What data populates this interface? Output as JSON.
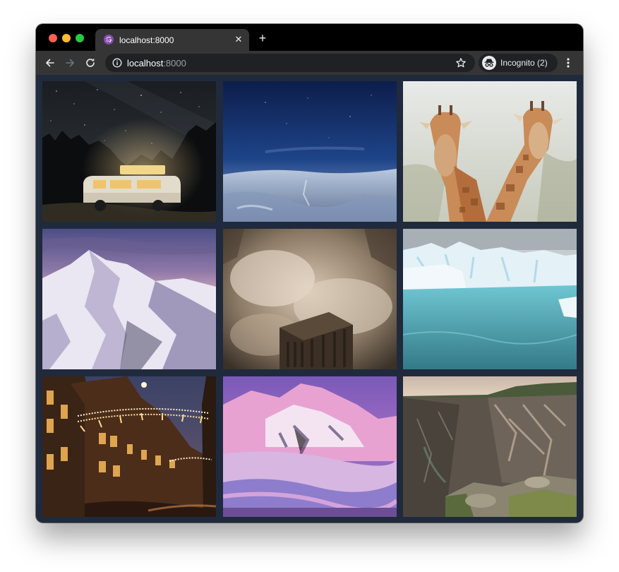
{
  "browser": {
    "tab_title": "localhost:8000",
    "tab_close_glyph": "✕",
    "new_tab_glyph": "+",
    "url_host": "localhost",
    "url_port": ":8000",
    "profile_label": "Incognito (2)"
  },
  "icons": {
    "back": "arrow-left-icon",
    "forward": "arrow-right-icon",
    "reload": "reload-icon",
    "info": "info-icon",
    "bookmark": "star-icon",
    "incognito": "incognito-icon",
    "menu": "kebab-menu-icon",
    "favicon": "gatsby-favicon-icon"
  },
  "colors": {
    "page_background": "#1f2a3d",
    "tabstrip": "#000000",
    "toolbar": "#353535",
    "omnibox": "#202124",
    "favicon": "#8a4baf"
  },
  "gallery": {
    "photos": [
      {
        "subject": "camper van under starry night sky"
      },
      {
        "subject": "snowy field under blue night sky"
      },
      {
        "subject": "two giraffes"
      },
      {
        "subject": "snowy mountain at dusk"
      },
      {
        "subject": "skyscraper above clouds"
      },
      {
        "subject": "glacier and turquoise lake"
      },
      {
        "subject": "street with holiday lights at night"
      },
      {
        "subject": "pink-lit snowy mountains"
      },
      {
        "subject": "canyon cliffs"
      }
    ]
  }
}
